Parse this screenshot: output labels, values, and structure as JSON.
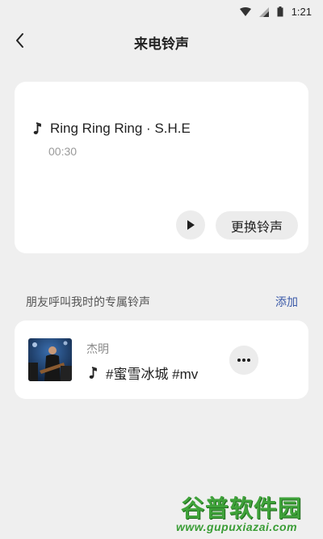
{
  "status_bar": {
    "time": "1:21"
  },
  "header": {
    "title": "来电铃声"
  },
  "current_ringtone": {
    "title": "Ring Ring Ring · S.H.E",
    "duration": "00:30",
    "change_button_label": "更换铃声"
  },
  "friends_section": {
    "label": "朋友呼叫我时的专属铃声",
    "add_label": "添加",
    "items": [
      {
        "name": "杰明",
        "song": "#蜜雪冰城 #mv"
      }
    ]
  },
  "watermark": {
    "logo": "谷普软件园",
    "url": "www.gupuxiazai.com"
  },
  "colors": {
    "background": "#efefef",
    "card": "#ffffff",
    "accent_link": "#3b5aa8",
    "watermark_green": "#3fa23a"
  }
}
